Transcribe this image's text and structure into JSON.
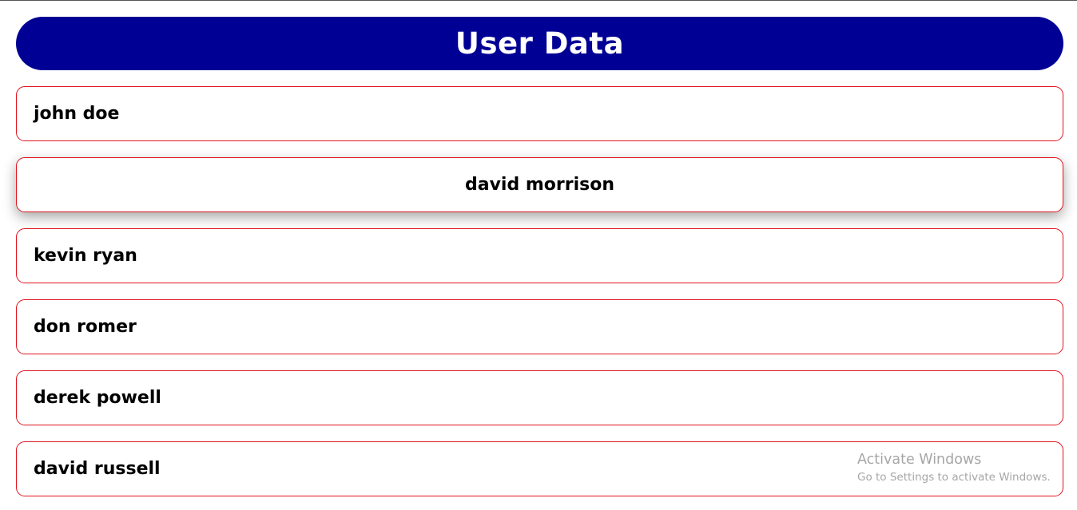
{
  "header": {
    "title": "User Data",
    "background_color": "#000094"
  },
  "users": [
    {
      "name": "john doe",
      "hovered": false
    },
    {
      "name": "david morrison",
      "hovered": true
    },
    {
      "name": "kevin ryan",
      "hovered": false
    },
    {
      "name": "don romer",
      "hovered": false
    },
    {
      "name": "derek powell",
      "hovered": false
    },
    {
      "name": "david russell",
      "hovered": false
    }
  ],
  "card_border_color": "#e0141e",
  "watermark": {
    "title": "Activate Windows",
    "subtitle": "Go to Settings to activate Windows."
  }
}
